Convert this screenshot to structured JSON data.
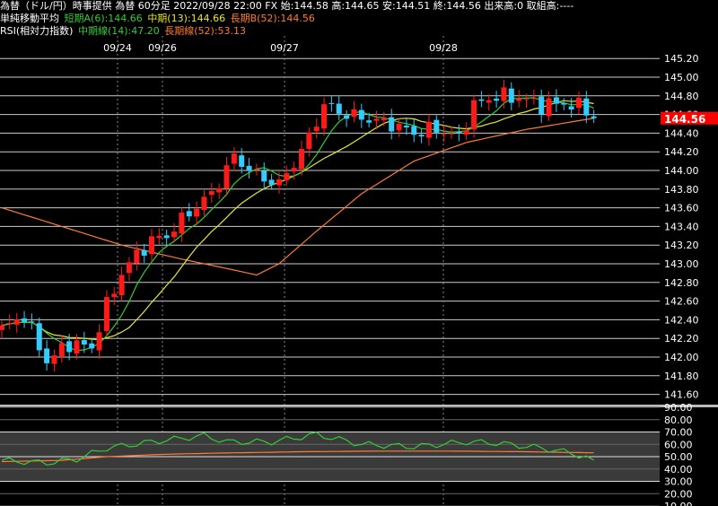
{
  "header": {
    "line1": "為替（ドル/円）時事提供 為替 60分足 2022/09/28 22:00 FX 始:144.58 高:144.65 安:144.51 終:144.56 出来高:0 取組高:----",
    "ma_title": "単純移動平均",
    "ma_short": "短期A(6):144.66",
    "ma_mid": "中期(13):144.66",
    "ma_long": "長期B(52):144.56",
    "rsi_title": "RSI(相対力指数)",
    "rsi_mid": "中期線(14):47.20",
    "rsi_long": "長期線(52):53.13"
  },
  "colors": {
    "up": "#ff1a1a",
    "down": "#33ccff",
    "ma_short": "#33cc33",
    "ma_mid": "#e6e633",
    "ma_long": "#ff7a33",
    "price_tag": "#ff0000"
  },
  "chart_data": [
    {
      "type": "candlestick",
      "title": "為替（ドル/円）60分足",
      "x_tick_labels": [
        "09/24",
        "09/26",
        "09/27",
        "09/28"
      ],
      "y_ticks": [
        141.6,
        141.8,
        142.0,
        142.2,
        142.4,
        142.6,
        142.8,
        143.0,
        143.2,
        143.4,
        143.6,
        143.8,
        144.0,
        144.2,
        144.4,
        144.6,
        144.8,
        145.0,
        145.2
      ],
      "ylim": [
        141.5,
        145.25
      ],
      "last_price": "144.56",
      "last_bar": {
        "open": 144.58,
        "high": 144.65,
        "low": 144.51,
        "close": 144.56
      },
      "ma_legend": [
        "短期A(6)",
        "中期(13)",
        "長期B(52)"
      ],
      "close_anchors": [
        [
          0,
          142.3
        ],
        [
          3,
          142.45
        ],
        [
          6,
          141.95
        ],
        [
          9,
          142.15
        ],
        [
          12,
          142.1
        ],
        [
          14,
          142.55
        ],
        [
          16,
          142.9
        ],
        [
          18,
          143.1
        ],
        [
          20,
          143.25
        ],
        [
          22,
          143.3
        ],
        [
          25,
          143.55
        ],
        [
          28,
          143.75
        ],
        [
          31,
          144.15
        ],
        [
          34,
          143.95
        ],
        [
          37,
          143.85
        ],
        [
          40,
          144.2
        ],
        [
          43,
          144.7
        ],
        [
          46,
          144.6
        ],
        [
          49,
          144.55
        ],
        [
          52,
          144.5
        ],
        [
          55,
          144.4
        ],
        [
          58,
          144.45
        ],
        [
          61,
          144.35
        ],
        [
          63,
          144.7
        ],
        [
          66,
          144.8
        ],
        [
          69,
          144.78
        ],
        [
          72,
          144.7
        ],
        [
          75,
          144.72
        ],
        [
          78,
          144.66
        ],
        [
          79,
          144.56
        ]
      ],
      "ma_long_anchors": [
        [
          0,
          143.6
        ],
        [
          8,
          143.4
        ],
        [
          16,
          143.2
        ],
        [
          24,
          143.05
        ],
        [
          30,
          142.95
        ],
        [
          34,
          142.88
        ],
        [
          37,
          143.0
        ],
        [
          42,
          143.35
        ],
        [
          48,
          143.75
        ],
        [
          55,
          144.1
        ],
        [
          62,
          144.3
        ],
        [
          70,
          144.44
        ],
        [
          79,
          144.56
        ]
      ]
    },
    {
      "type": "line",
      "title": "RSI(相対力指数)",
      "y_ticks": [
        10,
        20,
        30,
        40,
        50,
        60,
        70,
        80,
        90
      ],
      "ylim": [
        10,
        90
      ],
      "series": [
        {
          "name": "中期線(14)",
          "anchors": [
            [
              0,
              47
            ],
            [
              6,
              45
            ],
            [
              10,
              48
            ],
            [
              14,
              57
            ],
            [
              20,
              62
            ],
            [
              27,
              67
            ],
            [
              30,
              62
            ],
            [
              36,
              62
            ],
            [
              42,
              68
            ],
            [
              48,
              60
            ],
            [
              55,
              58
            ],
            [
              62,
              62
            ],
            [
              66,
              61
            ],
            [
              72,
              57
            ],
            [
              76,
              53
            ],
            [
              79,
              47.2
            ]
          ]
        },
        {
          "name": "長期線(52)",
          "anchors": [
            [
              0,
              46
            ],
            [
              8,
              47
            ],
            [
              14,
              50
            ],
            [
              22,
              52
            ],
            [
              30,
              53
            ],
            [
              40,
              54
            ],
            [
              50,
              54.5
            ],
            [
              60,
              54.5
            ],
            [
              70,
              54
            ],
            [
              79,
              53.13
            ]
          ]
        }
      ]
    }
  ]
}
